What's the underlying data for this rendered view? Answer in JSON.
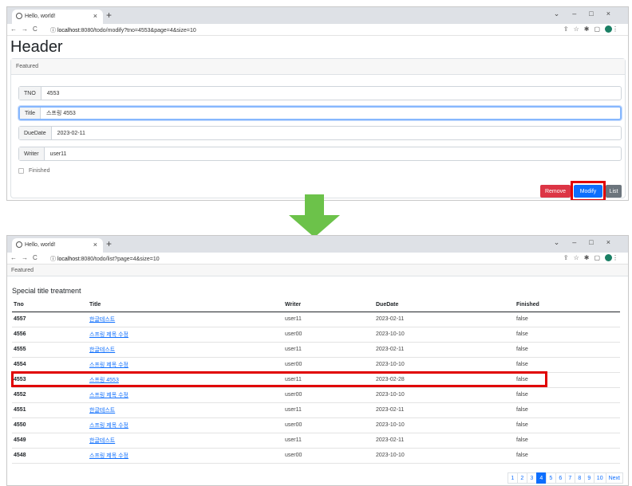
{
  "top": {
    "tab_title": "Hello, world!",
    "url_host": "localhost",
    "url_rest": ":8080/todo/modify?tno=4553&page=4&size=10",
    "header": "Header",
    "card_header": "Featured",
    "fields": [
      {
        "label": "TNO",
        "value": "4553"
      },
      {
        "label": "Title",
        "value": "스프링 4553"
      },
      {
        "label": "DueDate",
        "value": "2023-02-11"
      },
      {
        "label": "Writer",
        "value": "user11"
      }
    ],
    "finished_label": "Finished",
    "buttons": {
      "remove": "Remove",
      "modify": "Modify",
      "list": "List"
    }
  },
  "bottom": {
    "tab_title": "Hello, world!",
    "url_host": "localhost",
    "url_rest": ":8080/todo/list?page=4&size=10",
    "featured": "Featured",
    "card_title": "Special title treatment",
    "columns": [
      "Tno",
      "Title",
      "Writer",
      "DueDate",
      "Finished"
    ],
    "rows": [
      [
        "4557",
        "한글테스트",
        "user11",
        "2023-02-11",
        "false"
      ],
      [
        "4556",
        "스프링 제목 수정",
        "user00",
        "2023-10-10",
        "false"
      ],
      [
        "4555",
        "한글테스트",
        "user11",
        "2023-02-11",
        "false"
      ],
      [
        "4554",
        "스프링 제목 수정",
        "user00",
        "2023-10-10",
        "false"
      ],
      [
        "4553",
        "스프링 4553",
        "user11",
        "2023-02-28",
        "false"
      ],
      [
        "4552",
        "스프링 제목 수정",
        "user00",
        "2023-10-10",
        "false"
      ],
      [
        "4551",
        "한글테스트",
        "user11",
        "2023-02-11",
        "false"
      ],
      [
        "4550",
        "스프링 제목 수정",
        "user00",
        "2023-10-10",
        "false"
      ],
      [
        "4549",
        "한글테스트",
        "user11",
        "2023-02-11",
        "false"
      ],
      [
        "4548",
        "스프링 제목 수정",
        "user00",
        "2023-10-10",
        "false"
      ]
    ],
    "pages": [
      "1",
      "2",
      "3",
      "4",
      "5",
      "6",
      "7",
      "8",
      "9",
      "10",
      "Next"
    ],
    "active_page": "4"
  },
  "colors": {
    "highlight": "#e00000",
    "arrow": "#6cc24a",
    "primary": "#0d6efd",
    "danger": "#dc3545"
  }
}
